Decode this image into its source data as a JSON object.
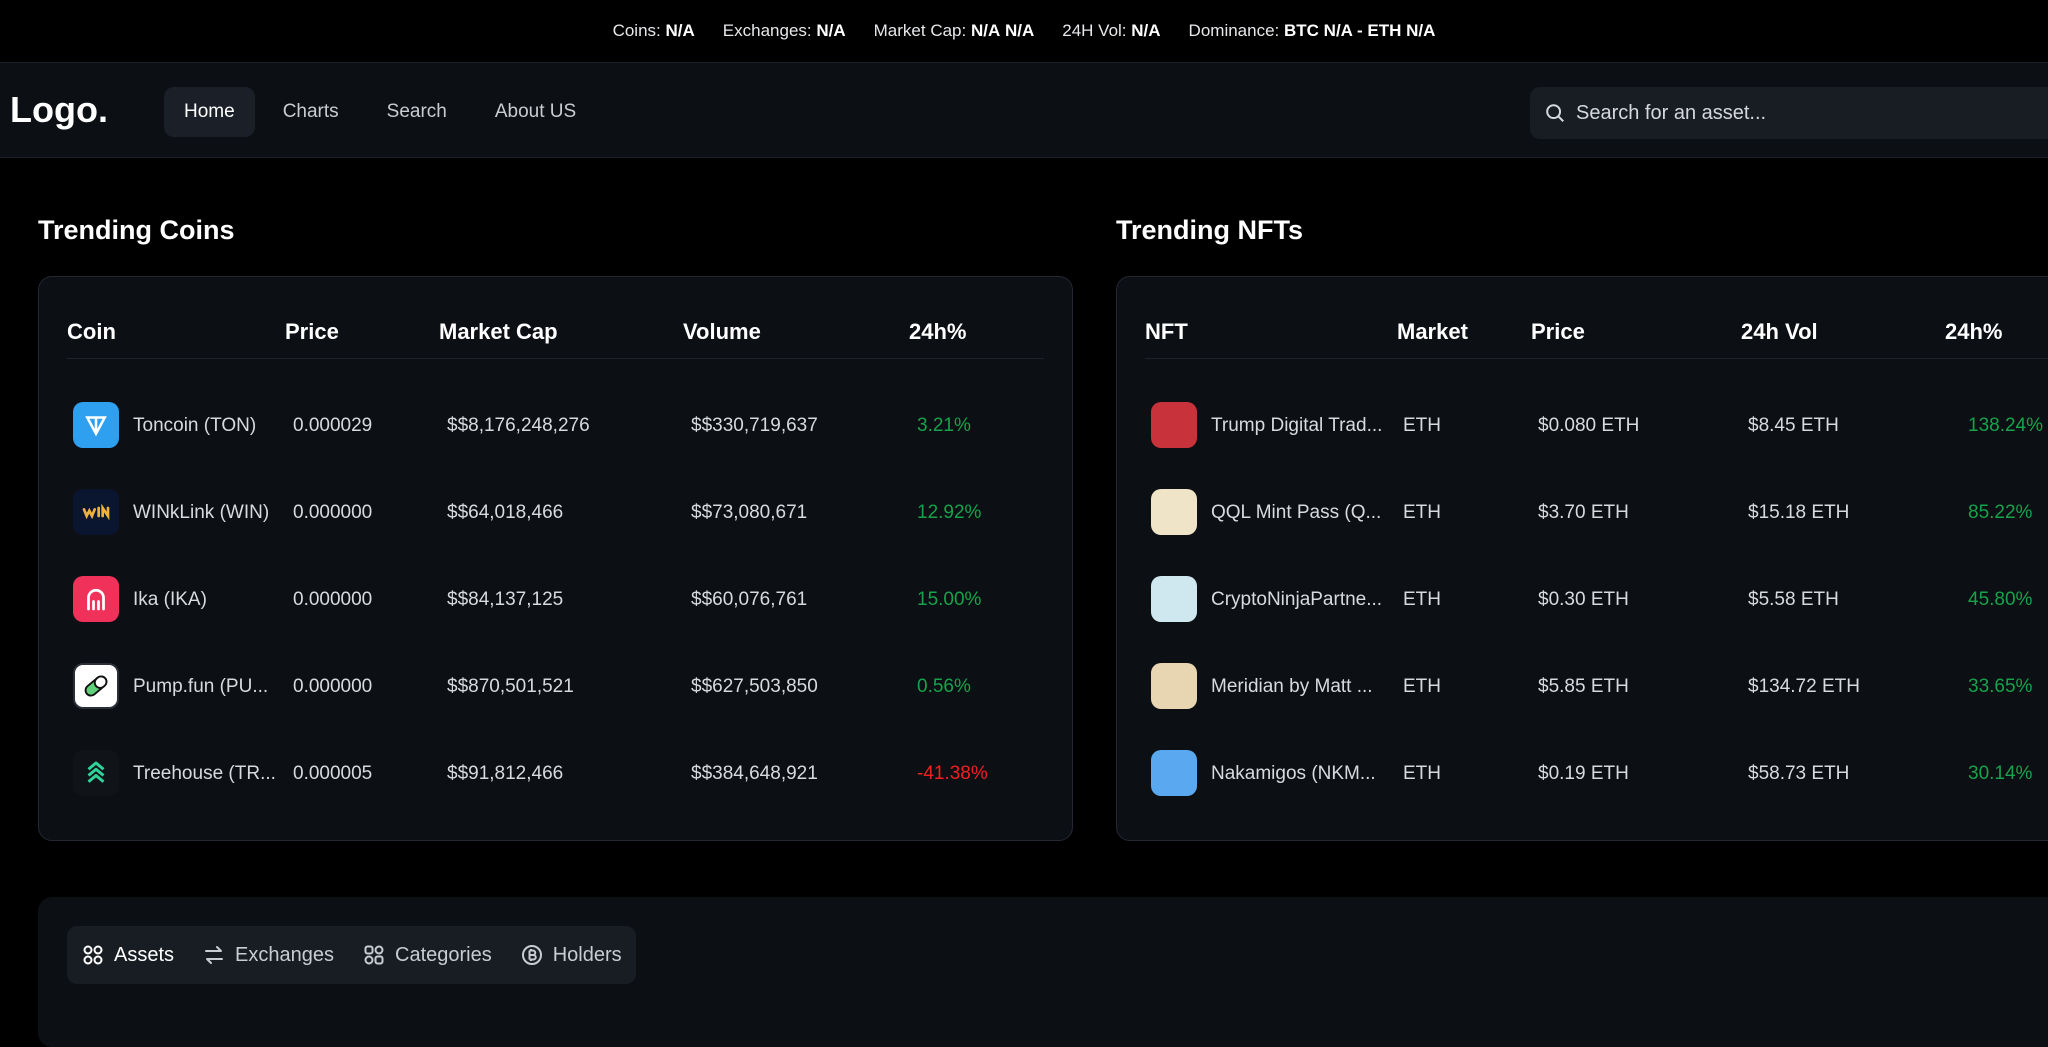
{
  "ticker": {
    "coins_label": "Coins:",
    "coins_value": "N/A",
    "exchanges_label": "Exchanges:",
    "exchanges_value": "N/A",
    "marketcap_label": "Market Cap:",
    "marketcap_value": "N/A",
    "marketcap_extra": "N/A",
    "vol_label": "24H Vol:",
    "vol_value": "N/A",
    "dominance_label": "Dominance:",
    "dominance_value": "BTC N/A - ETH N/A"
  },
  "nav": {
    "logo": "Logo.",
    "links": [
      "Home",
      "Charts",
      "Search",
      "About US"
    ],
    "search_placeholder": "Search for an asset..."
  },
  "trending_coins": {
    "title": "Trending Coins",
    "headers": [
      "Coin",
      "Price",
      "Market Cap",
      "Volume",
      "24h%"
    ],
    "rows": [
      {
        "name": "Toncoin (TON)",
        "price": "0.000029",
        "market_cap": "$$8,176,248,276",
        "volume": "$$330,719,637",
        "change": "3.21%",
        "direction": "up",
        "icon": "toncoin-icon",
        "color": "#2f9ff0"
      },
      {
        "name": "WINkLink (WIN)",
        "price": "0.000000",
        "market_cap": "$$64,018,466",
        "volume": "$$73,080,671",
        "change": "12.92%",
        "direction": "up",
        "icon": "winklink-icon",
        "color": "#0a1530"
      },
      {
        "name": "Ika (IKA)",
        "price": "0.000000",
        "market_cap": "$$84,137,125",
        "volume": "$$60,076,761",
        "change": "15.00%",
        "direction": "up",
        "icon": "ika-icon",
        "color": "#f0325a"
      },
      {
        "name": "Pump.fun (PU...",
        "price": "0.000000",
        "market_cap": "$$870,501,521",
        "volume": "$$627,503,850",
        "change": "0.56%",
        "direction": "up",
        "icon": "pumpfun-icon",
        "color": "#ffffff"
      },
      {
        "name": "Treehouse (TR...",
        "price": "0.000005",
        "market_cap": "$$91,812,466",
        "volume": "$$384,648,921",
        "change": "-41.38%",
        "direction": "down",
        "icon": "treehouse-icon",
        "color": "#101418"
      }
    ]
  },
  "trending_nfts": {
    "title": "Trending NFTs",
    "headers": [
      "NFT",
      "Market",
      "Price",
      "24h Vol",
      "24h%"
    ],
    "rows": [
      {
        "name": "Trump Digital Trad...",
        "market": "ETH",
        "price": "$0.080 ETH",
        "volume": "$8.45 ETH",
        "change": "138.24%",
        "icon": "trump-nft-icon",
        "color": "#c8323a"
      },
      {
        "name": "QQL Mint Pass (Q...",
        "market": "ETH",
        "price": "$3.70 ETH",
        "volume": "$15.18 ETH",
        "change": "85.22%",
        "icon": "qql-nft-icon",
        "color": "#efe3c8"
      },
      {
        "name": "CryptoNinjaPartne...",
        "market": "ETH",
        "price": "$0.30 ETH",
        "volume": "$5.58 ETH",
        "change": "45.80%",
        "icon": "ninja-nft-icon",
        "color": "#cfe7ee"
      },
      {
        "name": "Meridian by Matt ...",
        "market": "ETH",
        "price": "$5.85 ETH",
        "volume": "$134.72 ETH",
        "change": "33.65%",
        "icon": "meridian-nft-icon",
        "color": "#e8d6b3"
      },
      {
        "name": "Nakamigos (NKM...",
        "market": "ETH",
        "price": "$0.19 ETH",
        "volume": "$58.73 ETH",
        "change": "30.14%",
        "icon": "nakamigos-nft-icon",
        "color": "#5aa8f0"
      }
    ]
  },
  "bottom_tabs": [
    "Assets",
    "Exchanges",
    "Categories",
    "Holders"
  ],
  "colors": {
    "positive": "#16a34a",
    "negative": "#ef2020",
    "background": "#000000",
    "card": "#0c0f14"
  }
}
